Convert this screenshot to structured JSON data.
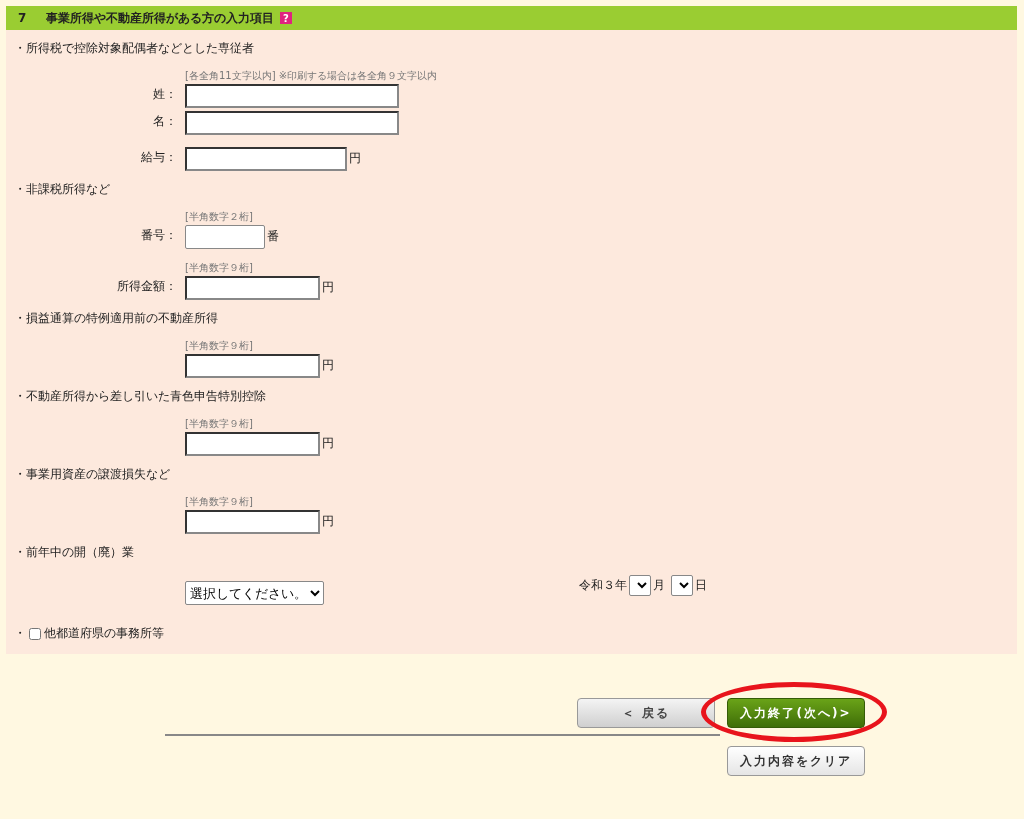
{
  "header": {
    "number": "7",
    "title": "事業所得や不動産所得がある方の入力項目",
    "help": "?"
  },
  "sections": [
    {
      "kind": "group",
      "title": "・所得税で控除対象配偶者などとした専従者",
      "rows": [
        {
          "kind": "text",
          "hint": "[各全角11文字以内] ※印刷する場合は各全角９文字以内",
          "label": "姓："
        },
        {
          "kind": "text",
          "label": "名："
        },
        {
          "kind": "text",
          "label": "給与：",
          "unit": "円"
        }
      ]
    },
    {
      "kind": "group",
      "title": "・非課税所得など",
      "rows": [
        {
          "kind": "text",
          "hint": "[半角数字２桁]",
          "label": "番号：",
          "unit": "番"
        },
        {
          "kind": "text",
          "hint": "[半角数字９桁]",
          "label": "所得金額：",
          "unit": "円"
        }
      ]
    },
    {
      "kind": "group",
      "title": "・損益通算の特例適用前の不動産所得",
      "rows": [
        {
          "kind": "text",
          "hint": "[半角数字９桁]",
          "unit": "円"
        }
      ]
    },
    {
      "kind": "group",
      "title": "・不動産所得から差し引いた青色申告特別控除",
      "rows": [
        {
          "kind": "text",
          "hint": "[半角数字９桁]",
          "unit": "円"
        }
      ]
    },
    {
      "kind": "group",
      "title": "・事業用資産の譲渡損失など",
      "rows": [
        {
          "kind": "text",
          "hint": "[半角数字９桁]",
          "unit": "円"
        }
      ]
    },
    {
      "kind": "group",
      "title": "・前年中の開（廃）業",
      "rows": [
        {
          "kind": "select_date",
          "select": "選択してください。",
          "era": "令和３年",
          "month_unit": "月",
          "day_unit": "日"
        }
      ]
    },
    {
      "kind": "checkbox",
      "bullet": "・",
      "label": "他都道府県の事務所等",
      "checked": false
    }
  ],
  "buttons": {
    "back": "＜ 戻る",
    "next": {
      "label": "入力終了(次へ)>",
      "circled": true
    },
    "clear": "入力内容をクリア"
  }
}
